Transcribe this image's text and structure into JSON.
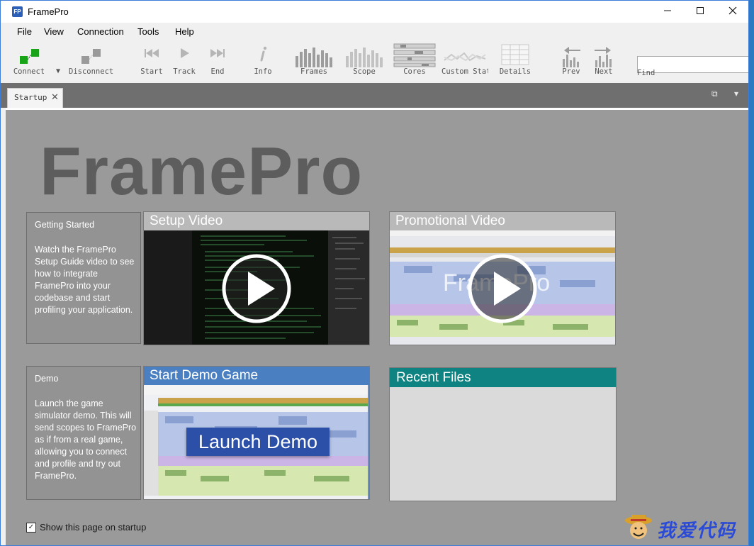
{
  "window": {
    "title": "FramePro",
    "app_icon": "FP",
    "min": "—",
    "max": "☐",
    "close": "✕"
  },
  "menu": [
    "File",
    "View",
    "Connection",
    "Tools",
    "Help"
  ],
  "toolbar": {
    "connect": "Connect",
    "dropdown": "▼",
    "disconnect": "Disconnect",
    "start": "Start",
    "track": "Track",
    "end": "End",
    "info": "Info",
    "frames": "Frames",
    "scope": "Scope",
    "cores": "Cores",
    "custom_stats": "Custom Stats",
    "details": "Details",
    "prev": "Prev",
    "next": "Next",
    "find_label": "Find",
    "find_value": ""
  },
  "tab": {
    "label": "Startup",
    "close": "✕",
    "restore": "⧉",
    "menu": "▾"
  },
  "start_page": {
    "logo": "FramePro",
    "getting_started": {
      "title": "Getting Started",
      "text": "Watch the FramePro Setup Guide video to see how to integrate FramePro into your codebase and start profiling your application."
    },
    "setup_video": {
      "title": "Setup Video"
    },
    "promo_video": {
      "title": "Promotional Video",
      "overlay": "FramePro"
    },
    "demo": {
      "title": "Demo",
      "text": "Launch the game simulator demo. This will send scopes to FramePro as if from a real game, allowing you to connect and profile and try out FramePro."
    },
    "start_demo": {
      "title": "Start Demo Game",
      "button": "Launch Demo"
    },
    "recent_files": {
      "title": "Recent Files"
    },
    "show_on_startup": {
      "label": "Show this page on startup",
      "checked": true
    }
  },
  "watermark": {
    "text": "我爱代码"
  },
  "colors": {
    "content_bg": "#9a9a9a",
    "recent_header": "#0e8381",
    "demo_header": "#4a7fc1",
    "logo": "#5d5d5d",
    "connect_green": "#19a319"
  }
}
